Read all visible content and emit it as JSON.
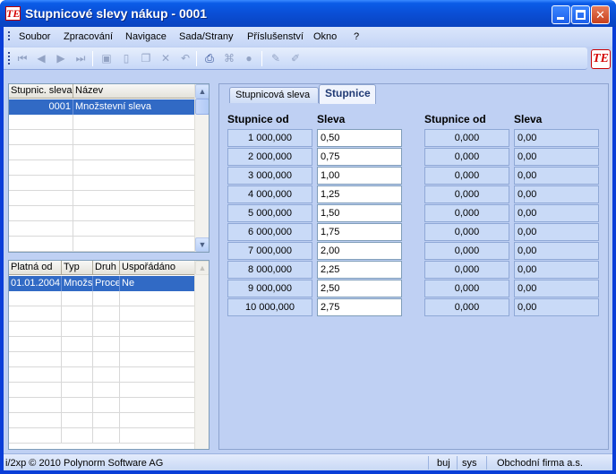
{
  "window": {
    "title": "Stupnicové slevy nákup - 0001",
    "icon": "app-logo-icon",
    "logo_text": "TE"
  },
  "menu": [
    "Soubor",
    "Zpracování",
    "Navigace",
    "Sada/Strany",
    "Příslušenství",
    "Okno",
    "?"
  ],
  "toolbar": {
    "icons": [
      "first-record-icon",
      "previous-record-icon",
      "next-record-icon",
      "last-record-icon",
      "save-icon",
      "new-icon",
      "copy-icon",
      "delete-icon",
      "undo-icon",
      "print-icon",
      "structure-icon",
      "stop-icon",
      "edit-icon",
      "clear-icon"
    ]
  },
  "top_grid": {
    "columns": [
      "Stupnic. sleva",
      "Název"
    ],
    "rows": [
      {
        "code": "0001",
        "name": "Množstevní sleva"
      }
    ]
  },
  "bottom_grid": {
    "columns": [
      "Platná od",
      "Typ",
      "Druh",
      "Uspořádáno"
    ],
    "rows": [
      {
        "valid_from": "01.01.2004",
        "type": "Množs",
        "kind": "Proce",
        "arranged": "Ne"
      }
    ]
  },
  "tabs": {
    "first": "Stupnicová sleva",
    "second": "Stupnice",
    "active": "Stupnice"
  },
  "scale": {
    "headers": {
      "from": "Stupnice od",
      "discount": "Sleva"
    },
    "left": [
      {
        "from": "1 000,000",
        "discount": "0,50"
      },
      {
        "from": "2 000,000",
        "discount": "0,75"
      },
      {
        "from": "3 000,000",
        "discount": "1,00"
      },
      {
        "from": "4 000,000",
        "discount": "1,25"
      },
      {
        "from": "5 000,000",
        "discount": "1,50"
      },
      {
        "from": "6 000,000",
        "discount": "1,75"
      },
      {
        "from": "7 000,000",
        "discount": "2,00"
      },
      {
        "from": "8 000,000",
        "discount": "2,25"
      },
      {
        "from": "9 000,000",
        "discount": "2,50"
      },
      {
        "from": "10 000,000",
        "discount": "2,75"
      }
    ],
    "right": [
      {
        "from": "0,000",
        "discount": "0,00"
      },
      {
        "from": "0,000",
        "discount": "0,00"
      },
      {
        "from": "0,000",
        "discount": "0,00"
      },
      {
        "from": "0,000",
        "discount": "0,00"
      },
      {
        "from": "0,000",
        "discount": "0,00"
      },
      {
        "from": "0,000",
        "discount": "0,00"
      },
      {
        "from": "0,000",
        "discount": "0,00"
      },
      {
        "from": "0,000",
        "discount": "0,00"
      },
      {
        "from": "0,000",
        "discount": "0,00"
      },
      {
        "from": "0,000",
        "discount": "0,00"
      }
    ]
  },
  "status": {
    "copyright": "i/2xp © 2010 Polynorm Software AG",
    "user": "buj",
    "system": "sys",
    "company": "Obchodní firma a.s."
  },
  "colors": {
    "selection": "#316ac5",
    "titlebar": "#0a50d8",
    "panel": "#bfd0f3"
  }
}
